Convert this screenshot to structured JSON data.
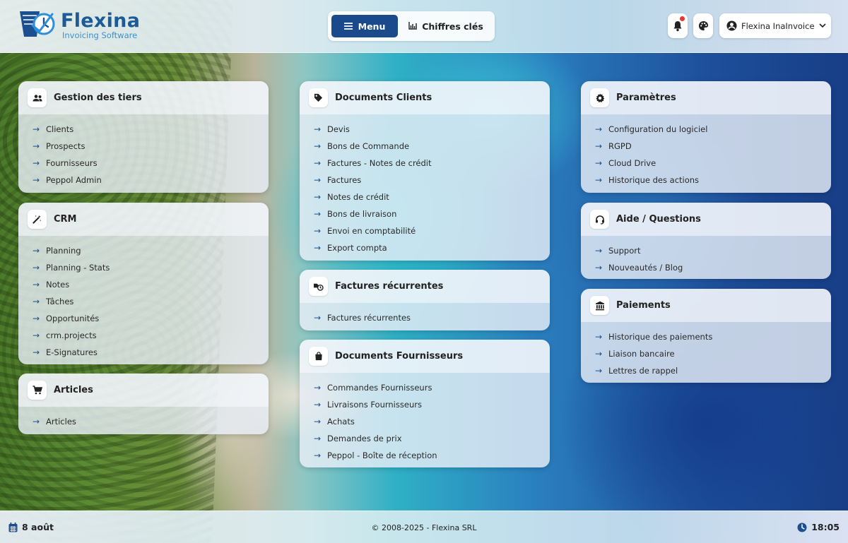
{
  "header": {
    "logo_title": "Flexina",
    "logo_subtitle": "Invoicing Software",
    "tab_menu": "Menu",
    "tab_kpi": "Chiffres clés",
    "user_name": "Flexina InaInvoices -"
  },
  "colors": {
    "accent": "#1a4a8c",
    "brand": "#1c5b96",
    "notification": "#e53935"
  },
  "cards": {
    "tiers": {
      "title": "Gestion des tiers",
      "icon": "people-icon",
      "items": [
        "Clients",
        "Prospects",
        "Fournisseurs",
        "Peppol Admin"
      ]
    },
    "crm": {
      "title": "CRM",
      "icon": "magic-wand-icon",
      "items": [
        "Planning",
        "Planning - Stats",
        "Notes",
        "Tâches",
        "Opportunités",
        "crm.projects",
        "E-Signatures"
      ]
    },
    "articles": {
      "title": "Articles",
      "icon": "cart-icon",
      "items": [
        "Articles"
      ]
    },
    "clients_docs": {
      "title": "Documents Clients",
      "icon": "tag-icon",
      "items": [
        "Devis",
        "Bons de Commande",
        "Factures - Notes de crédit",
        "Factures",
        "Notes de crédit",
        "Bons de livraison",
        "Envoi en comptabilité",
        "Export compta"
      ]
    },
    "recurring": {
      "title": "Factures récurrentes",
      "icon": "recurring-icon",
      "items": [
        "Factures récurrentes"
      ]
    },
    "suppliers_docs": {
      "title": "Documents Fournisseurs",
      "icon": "shopping-bag-icon",
      "items": [
        "Commandes Fournisseurs",
        "Livraisons Fournisseurs",
        "Achats",
        "Demandes de prix",
        "Peppol - Boîte de réception"
      ]
    },
    "settings": {
      "title": "Paramètres",
      "icon": "gear-icon",
      "items": [
        "Configuration du logiciel",
        "RGPD",
        "Cloud Drive",
        "Historique des actions"
      ]
    },
    "help": {
      "title": "Aide / Questions",
      "icon": "headset-icon",
      "items": [
        "Support",
        "Nouveautés / Blog"
      ]
    },
    "payments": {
      "title": "Paiements",
      "icon": "bank-icon",
      "items": [
        "Historique des paiements",
        "Liaison bancaire",
        "Lettres de rappel"
      ]
    }
  },
  "footer": {
    "date": "8 août",
    "copyright": "© 2008-2025 - Flexina SRL",
    "time": "18:05"
  }
}
